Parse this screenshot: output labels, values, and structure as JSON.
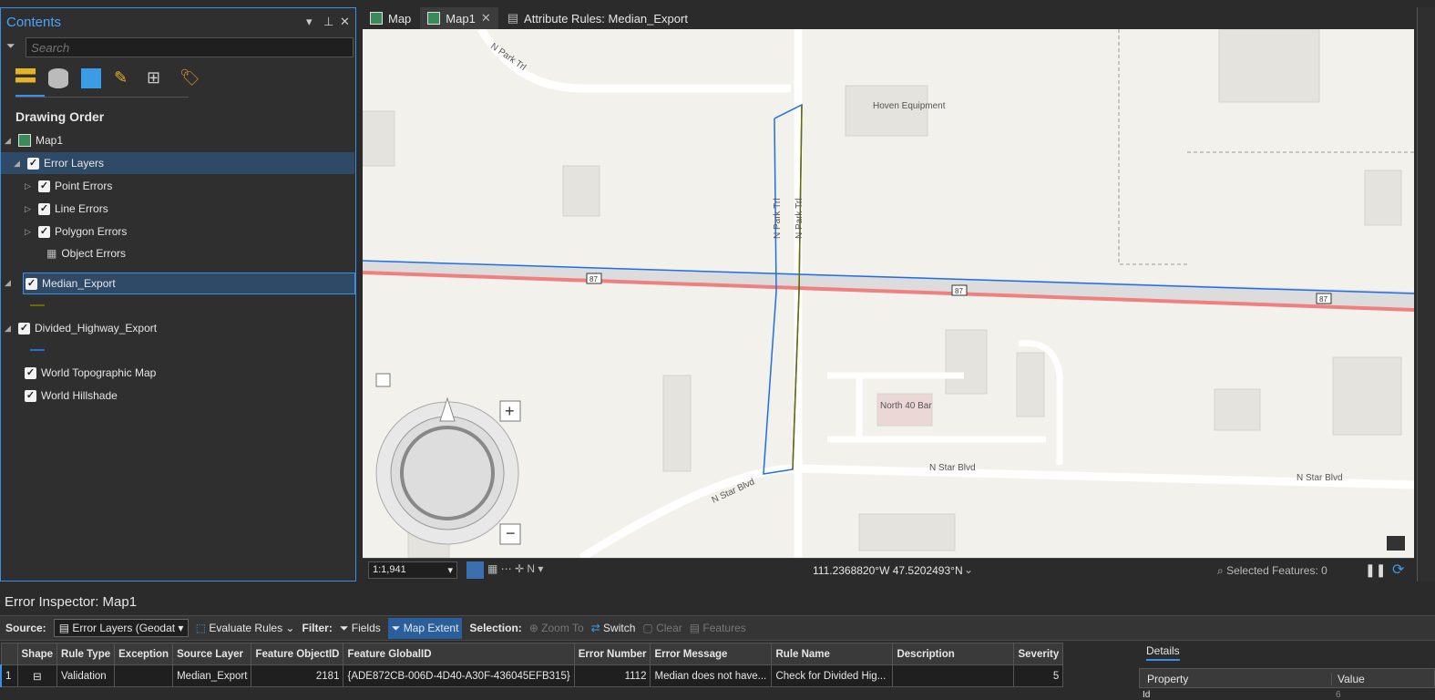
{
  "contents": {
    "title": "Contents",
    "search_placeholder": "Search",
    "heading": "Drawing Order",
    "layers": {
      "map": "Map1",
      "error_layers": "Error Layers",
      "point": "Point Errors",
      "line": "Line Errors",
      "polygon": "Polygon Errors",
      "object": "Object Errors",
      "median": "Median_Export",
      "divided": "Divided_Highway_Export",
      "topo": "World Topographic Map",
      "hillshade": "World Hillshade"
    }
  },
  "tabs": [
    "Map",
    "Map1",
    "Attribute Rules: Median_Export"
  ],
  "map": {
    "labels": {
      "npark_top": "N Park Trl",
      "npark_v1": "N Park Trl",
      "npark_v2": "N Park Trl",
      "hoven": "Hoven Equipment",
      "bar": "North 40 Bar",
      "star1": "N Star Blvd",
      "star2": "N Star Blvd",
      "star3": "N Star Blvd",
      "hw": "87"
    },
    "colors": {
      "highway_error": "#f08080",
      "median": "#6b6b00",
      "divided": "#1e6ee6"
    }
  },
  "status": {
    "scale": "1:1,941",
    "coords": "111.2368820°W 47.5202493°N",
    "selected": "Selected Features: 0"
  },
  "inspector": {
    "title": "Error Inspector: Map1",
    "source_label": "Source:",
    "source_value": "Error Layers (Geodat",
    "evaluate": "Evaluate Rules",
    "filter_label": "Filter:",
    "fields": "Fields",
    "map_extent": "Map Extent",
    "selection_label": "Selection:",
    "zoom_to": "Zoom To",
    "switch": "Switch",
    "clear": "Clear",
    "features": "Features",
    "columns": [
      "Shape",
      "Rule Type",
      "Exception",
      "Source Layer",
      "Feature ObjectID",
      "Feature GlobalID",
      "Error Number",
      "Error Message",
      "Rule Name",
      "Description",
      "Severity"
    ],
    "rows": [
      {
        "index": "1",
        "rule_type": "Validation",
        "exception": "",
        "source_layer": "Median_Export",
        "oid": "2181",
        "gid": "{ADE872CB-006D-4D40-A30F-436045EFB315}",
        "error_number": "1112",
        "message": "Median does not have...",
        "rule_name": "Check for Divided Hig...",
        "description": "",
        "severity": "5"
      }
    ],
    "details": {
      "tab": "Details",
      "property": "Property",
      "value": "Value",
      "row_prop": "Id",
      "row_val": "6"
    }
  }
}
